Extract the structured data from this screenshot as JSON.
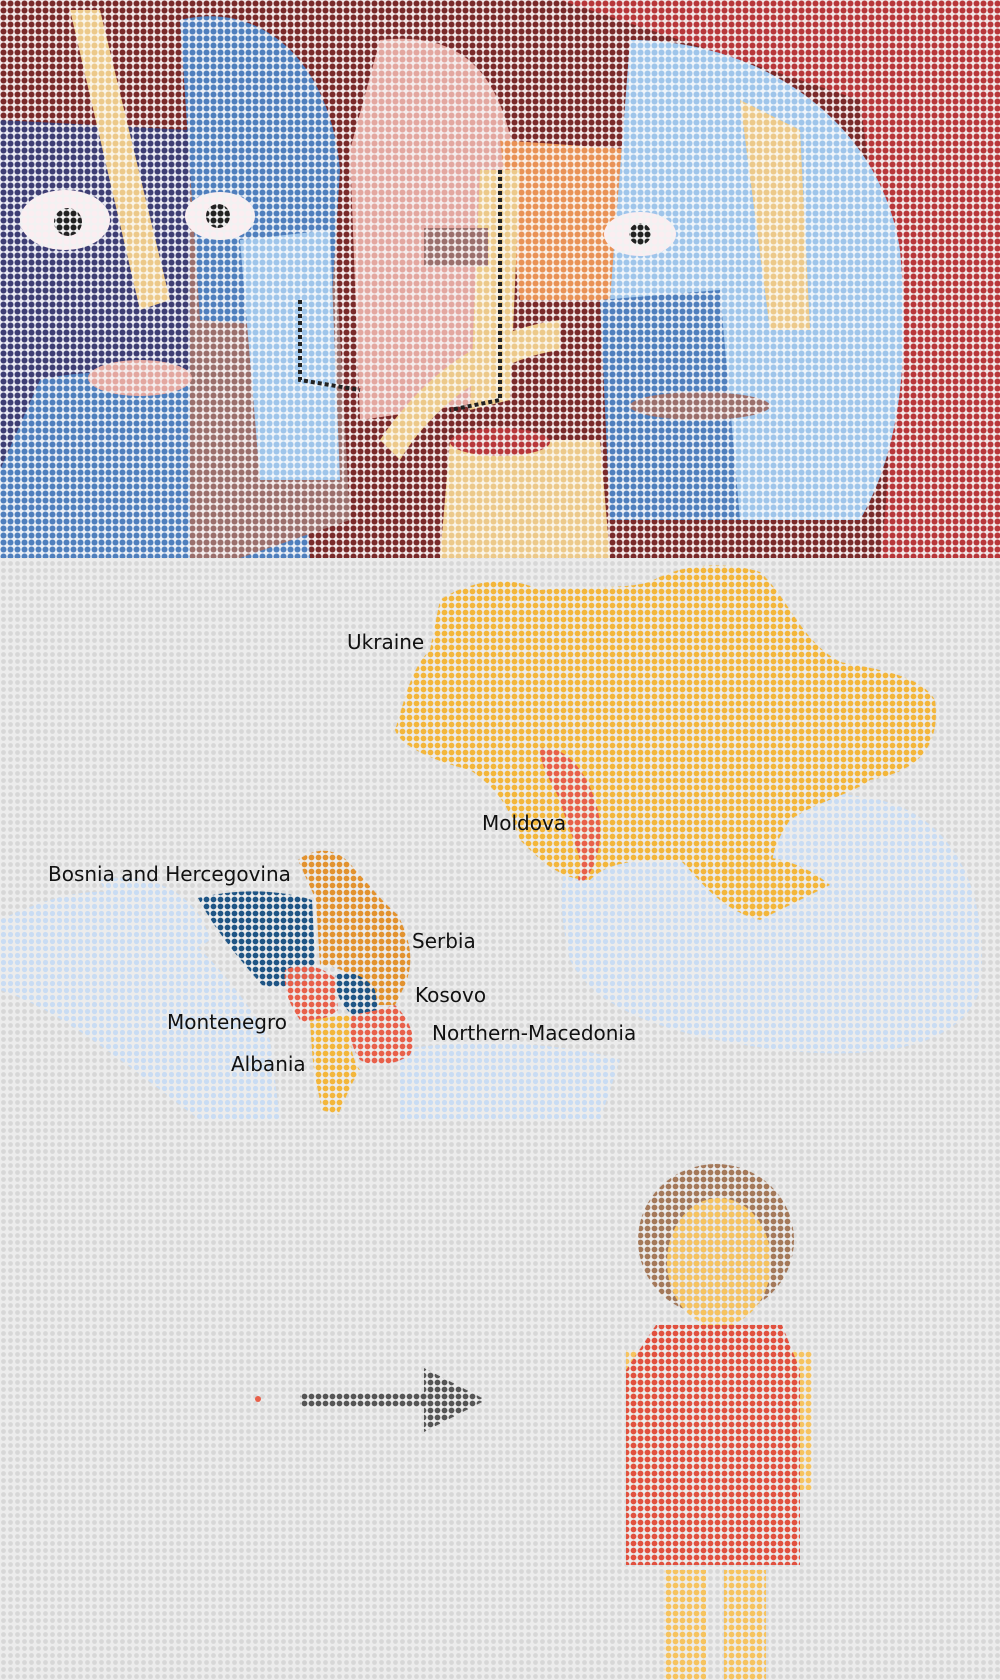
{
  "colors": {
    "background_dot": "#d7d7d7",
    "sea": "#c9dcf3",
    "ukraine": "#f3b63b",
    "moldova": "#e8604a",
    "serbia": "#e2922f",
    "bosnia": "#1f5585",
    "montenegro": "#e8604a",
    "kosovo": "#1f5585",
    "macedonia": "#e8604a",
    "albania": "#f3b63b",
    "arrow": "#555555",
    "small_dot": "#e8604a",
    "hair": "#a4795a",
    "skin": "#f6c35f",
    "dress": "#e1513f",
    "eye": "#222222"
  },
  "map": {
    "labels": [
      {
        "id": "ukraine",
        "text": "Ukraine"
      },
      {
        "id": "moldova",
        "text": "Moldova"
      },
      {
        "id": "bosnia",
        "text": "Bosnia and Hercegovina"
      },
      {
        "id": "serbia",
        "text": "Serbia"
      },
      {
        "id": "kosovo",
        "text": "Kosovo"
      },
      {
        "id": "montenegro",
        "text": "Montenegro"
      },
      {
        "id": "macedonia",
        "text": "Northern-Macedonia"
      },
      {
        "id": "albania",
        "text": "Albania"
      }
    ]
  },
  "icons": {
    "arrow": "arrow-right-icon",
    "person": "person-icon"
  }
}
